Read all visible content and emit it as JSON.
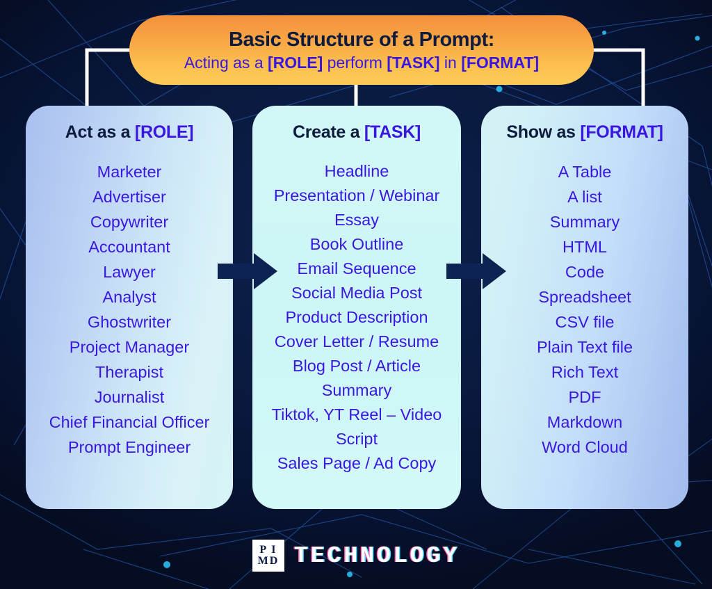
{
  "header": {
    "title": "Basic Structure of a Prompt:",
    "subtitle_parts": [
      {
        "text": "Acting as a ",
        "style": "plain"
      },
      {
        "text": "[ROLE]",
        "style": "bold"
      },
      {
        "text": " perform ",
        "style": "plain"
      },
      {
        "text": "[TASK]",
        "style": "bold"
      },
      {
        "text": " in ",
        "style": "plain"
      },
      {
        "text": "[FORMAT]",
        "style": "bold"
      }
    ],
    "subtitle_full": "Acting as a [ROLE] perform [TASK] in [FORMAT]",
    "bg_gradient_from": "#f3903c",
    "bg_gradient_to": "#fdcb58",
    "title_color": "#0d1b3e",
    "accent_color": "#3a17e0"
  },
  "columns": [
    {
      "id": "role",
      "heading_prefix": "Act as a ",
      "heading_placeholder": "[ROLE]",
      "items": [
        "Marketer",
        "Advertiser",
        "Copywriter",
        "Accountant",
        "Lawyer",
        "Analyst",
        "Ghostwriter",
        "Project Manager",
        "Therapist",
        "Journalist",
        "Chief Financial Officer",
        "Prompt Engineer"
      ]
    },
    {
      "id": "task",
      "heading_prefix": "Create a ",
      "heading_placeholder": "[TASK]",
      "items": [
        "Headline",
        "Presentation / Webinar",
        "Essay",
        "Book Outline",
        "Email Sequence",
        "Social Media Post",
        "Product Description",
        "Cover Letter / Resume",
        "Blog Post / Article",
        "Summary",
        "Tiktok, YT Reel – Video Script",
        "Sales Page / Ad Copy"
      ]
    },
    {
      "id": "format",
      "heading_prefix": "Show as ",
      "heading_placeholder": "[FORMAT]",
      "items": [
        "A Table",
        "A list",
        "Summary",
        "HTML",
        "Code",
        "Spreadsheet",
        "CSV file",
        "Plain Text file",
        "Rich Text",
        "PDF",
        "Markdown",
        "Word Cloud"
      ]
    }
  ],
  "arrows": [
    {
      "name": "arrow-role-to-task",
      "color": "#0d2452"
    },
    {
      "name": "arrow-task-to-format",
      "color": "#0d2452"
    }
  ],
  "footer": {
    "logo_line1": "P I",
    "logo_line2": "MD",
    "wordmark": "TECHNOLOGY",
    "wordmark_color": "#ffffff",
    "glitch_pink": "#ff59b0",
    "glitch_cyan": "#4ad9ff"
  },
  "theme": {
    "background": "#071333",
    "card_text_color": "#3a17e0",
    "heading_dark": "#0d1b3e",
    "connector_line_color": "#ffffff",
    "network_line_color": "#2a6fd0",
    "network_node_color": "#29b6e8"
  }
}
